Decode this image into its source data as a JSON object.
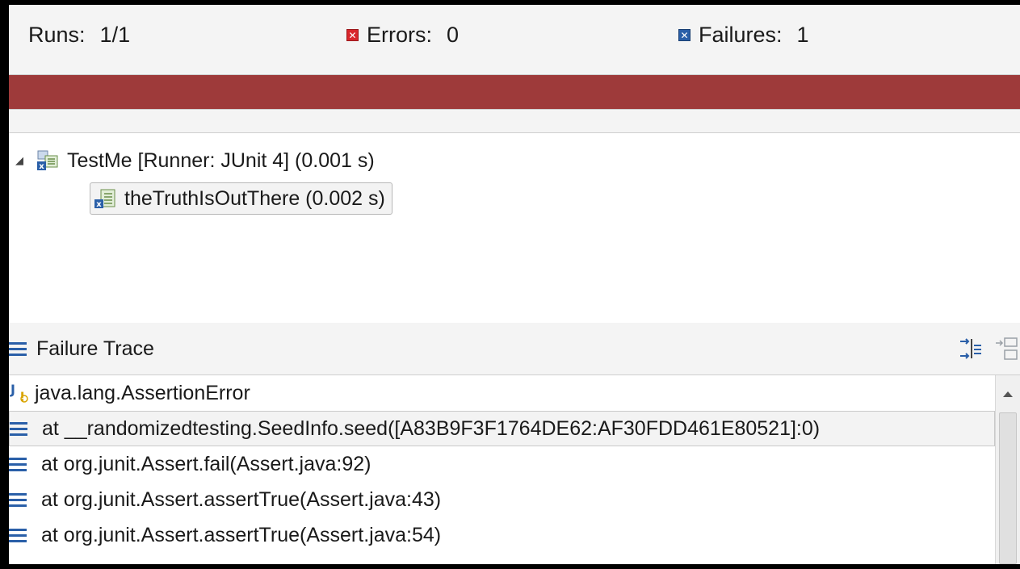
{
  "counters": {
    "runs_label": "Runs:",
    "runs_value": "1/1",
    "errors_label": "Errors:",
    "errors_value": "0",
    "failures_label": "Failures:",
    "failures_value": "1",
    "error_icon": "error-icon",
    "failure_icon": "failure-icon"
  },
  "progress": {
    "fraction": 1.0,
    "status": "failed",
    "color": "#9e3a3a"
  },
  "tree": {
    "suite": {
      "label": "TestMe [Runner: JUnit 4] (0.001 s)",
      "expanded": true,
      "icon": "test-suite-failure-icon"
    },
    "cases": [
      {
        "label": "theTruthIsOutThere (0.002 s)",
        "selected": true,
        "icon": "test-case-failure-icon"
      }
    ]
  },
  "failure_trace": {
    "title": "Failure Trace",
    "title_icon": "stack-trace-icon",
    "buttons": [
      "filter-stack-trace-icon",
      "compare-results-icon"
    ],
    "lines": [
      {
        "text": "java.lang.AssertionError",
        "icon": "java-exception-icon",
        "selected": false
      },
      {
        "text": "at __randomizedtesting.SeedInfo.seed([A83B9F3F1764DE62:AF30FDD461E80521]:0)",
        "icon": "stack-frame-icon",
        "selected": true
      },
      {
        "text": "at org.junit.Assert.fail(Assert.java:92)",
        "icon": "stack-frame-icon",
        "selected": false
      },
      {
        "text": "at org.junit.Assert.assertTrue(Assert.java:43)",
        "icon": "stack-frame-icon",
        "selected": false
      },
      {
        "text": "at org.junit.Assert.assertTrue(Assert.java:54)",
        "icon": "stack-frame-icon",
        "selected": false
      }
    ]
  },
  "colors": {
    "accent": "#2a5fa8",
    "error": "#d9262b",
    "failure_bar": "#9e3a3a"
  }
}
